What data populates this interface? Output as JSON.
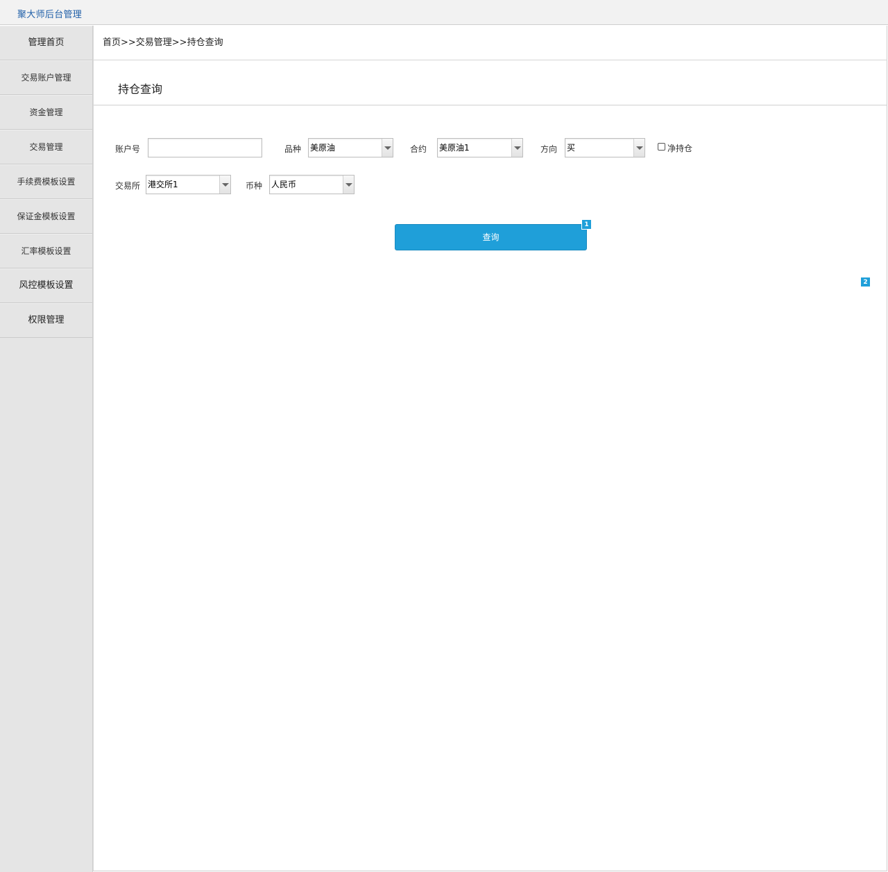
{
  "app": {
    "title": "聚大师后台管理"
  },
  "sidebar": {
    "items": [
      {
        "label": "管理首页"
      },
      {
        "label": "交易账户管理"
      },
      {
        "label": "资金管理"
      },
      {
        "label": "交易管理"
      },
      {
        "label": "手续费模板设置"
      },
      {
        "label": "保证金模板设置"
      },
      {
        "label": "汇率模板设置"
      },
      {
        "label": "风控模板设置"
      },
      {
        "label": "权限管理"
      }
    ]
  },
  "breadcrumb": {
    "text": "首页>>交易管理>>持仓查询"
  },
  "page": {
    "title": "持仓查询"
  },
  "form": {
    "account": {
      "label": "账户号",
      "value": ""
    },
    "variety": {
      "label": "品种",
      "value": "美原油"
    },
    "contract": {
      "label": "合约",
      "value": "美原油1"
    },
    "direction": {
      "label": "方向",
      "value": "买"
    },
    "net_position": {
      "label": "净持仓",
      "checked": false
    },
    "exchange": {
      "label": "交易所",
      "value": "港交所1"
    },
    "currency": {
      "label": "币种",
      "value": "人民币"
    }
  },
  "query_button": {
    "label": "查询"
  },
  "markers": {
    "m1": "1",
    "m2": "2"
  },
  "colors": {
    "accent": "#1f9fd9",
    "title": "#1f5fa8"
  }
}
